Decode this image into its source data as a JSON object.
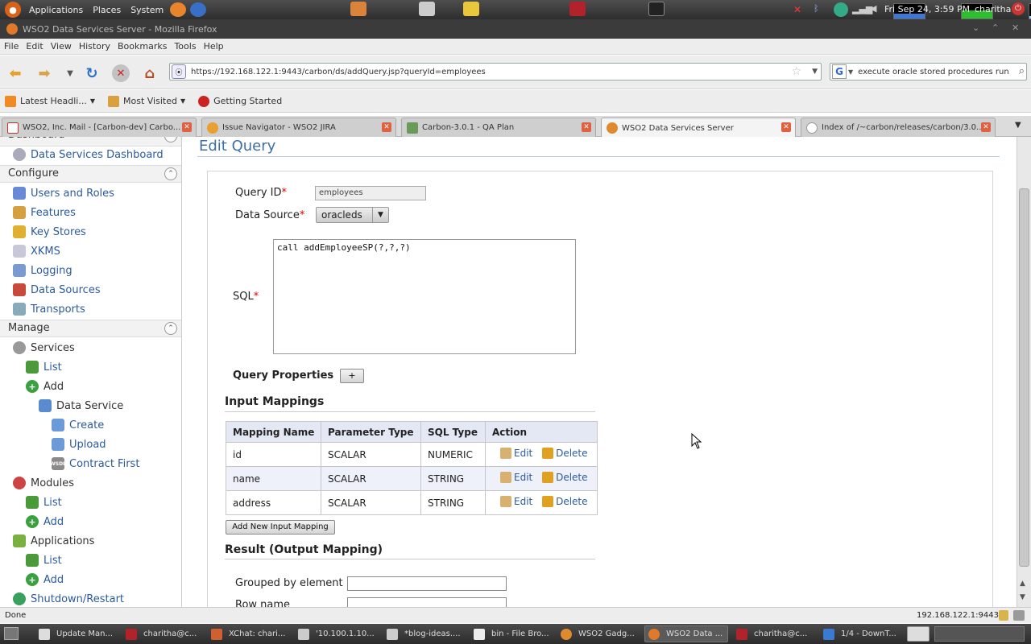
{
  "top_panel": {
    "menus": [
      "Applications",
      "Places",
      "System"
    ],
    "datetime": "Fri Sep 24,  3:59 PM",
    "user": "charitha"
  },
  "window": {
    "title": "WSO2 Data Services Server - Mozilla Firefox"
  },
  "menubar": [
    "File",
    "Edit",
    "View",
    "History",
    "Bookmarks",
    "Tools",
    "Help"
  ],
  "navigation": {
    "url": "https://192.168.122.1:9443/carbon/ds/addQuery.jsp?queryId=employees",
    "search_value": "execute oracle stored procedures run"
  },
  "bookmarks": [
    "Latest Headli...",
    "Most Visited",
    "Getting Started"
  ],
  "tabs": [
    {
      "label": "WSO2, Inc. Mail - [Carbon-dev] Carbo..."
    },
    {
      "label": "Issue Navigator - WSO2 JIRA"
    },
    {
      "label": "Carbon-3.0.1 - QA Plan"
    },
    {
      "label": "WSO2 Data Services Server"
    },
    {
      "label": "Index of /~carbon/releases/carbon/3.0..."
    }
  ],
  "sidebar": {
    "top_cut": "Dashboard",
    "dashboard_link": "Data Services Dashboard",
    "configure": {
      "title": "Configure",
      "items": [
        "Users and Roles",
        "Features",
        "Key Stores",
        "XKMS",
        "Logging",
        "Data Sources",
        "Transports"
      ]
    },
    "manage": {
      "title": "Manage",
      "services": "Services",
      "services_list": "List",
      "services_add": "Add",
      "data_service": "Data Service",
      "create": "Create",
      "upload": "Upload",
      "contract_first": "Contract First",
      "modules": "Modules",
      "modules_list": "List",
      "modules_add": "Add",
      "applications": "Applications",
      "applications_list": "List",
      "applications_add": "Add",
      "shutdown": "Shutdown/Restart"
    }
  },
  "main": {
    "title": "Edit Query",
    "query_id_label": "Query ID",
    "query_id_value": "employees",
    "data_source_label": "Data Source",
    "data_source_value": "oracleds",
    "sql_label": "SQL",
    "sql_value": "call addEmployeeSP(?,?,?)",
    "query_properties_label": "Query Properties",
    "plus_label": "+",
    "required_mark": "*",
    "input_mappings_title": "Input Mappings",
    "table": {
      "headers": [
        "Mapping Name",
        "Parameter Type",
        "SQL Type",
        "Action"
      ],
      "rows": [
        {
          "name": "id",
          "param": "SCALAR",
          "sql": "NUMERIC"
        },
        {
          "name": "name",
          "param": "SCALAR",
          "sql": "STRING"
        },
        {
          "name": "address",
          "param": "SCALAR",
          "sql": "STRING"
        }
      ],
      "edit_label": "Edit",
      "delete_label": "Delete"
    },
    "add_mapping_label": "Add New Input Mapping",
    "result_title": "Result (Output Mapping)",
    "grouped_label": "Grouped by element",
    "row_name_label": "Row name"
  },
  "status": {
    "left": "Done",
    "right": "192.168.122.1:9443"
  },
  "taskbar": [
    "Update Man...",
    "charitha@c...",
    "XChat: chari...",
    "'10.100.1.10...",
    "*blog-ideas....",
    "bin - File Bro...",
    "WSO2 Gadg...",
    "WSO2 Data ...",
    "charitha@c...",
    "1/4 - DownT..."
  ]
}
